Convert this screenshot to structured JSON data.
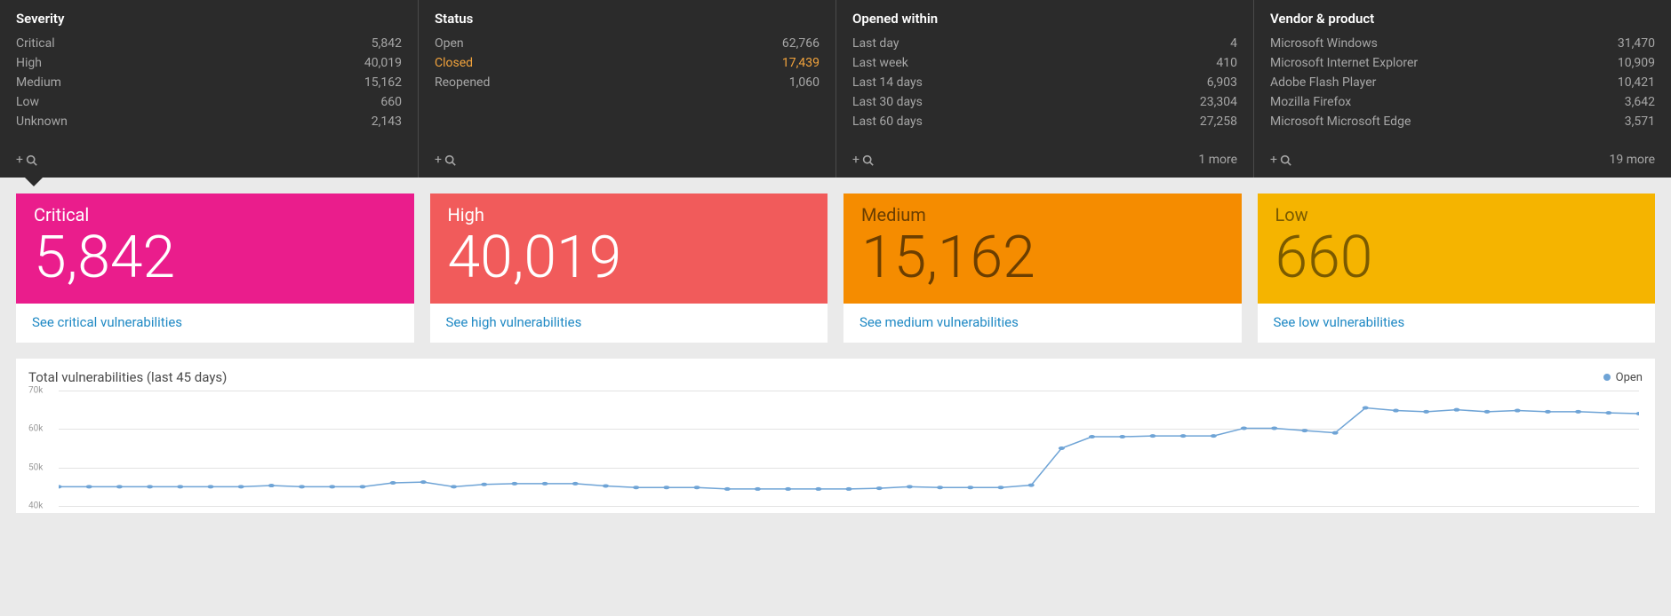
{
  "filters": {
    "severity": {
      "title": "Severity",
      "rows": [
        {
          "label": "Critical",
          "value": "5,842"
        },
        {
          "label": "High",
          "value": "40,019"
        },
        {
          "label": "Medium",
          "value": "15,162"
        },
        {
          "label": "Low",
          "value": "660"
        },
        {
          "label": "Unknown",
          "value": "2,143"
        }
      ],
      "more": ""
    },
    "status": {
      "title": "Status",
      "rows": [
        {
          "label": "Open",
          "value": "62,766"
        },
        {
          "label": "Closed",
          "value": "17,439",
          "highlight": true
        },
        {
          "label": "Reopened",
          "value": "1,060"
        }
      ],
      "more": ""
    },
    "opened": {
      "title": "Opened within",
      "rows": [
        {
          "label": "Last day",
          "value": "4"
        },
        {
          "label": "Last week",
          "value": "410"
        },
        {
          "label": "Last 14 days",
          "value": "6,903"
        },
        {
          "label": "Last 30 days",
          "value": "23,304"
        },
        {
          "label": "Last 60 days",
          "value": "27,258"
        }
      ],
      "more": "1 more"
    },
    "vendor": {
      "title": "Vendor & product",
      "rows": [
        {
          "label": "Microsoft Windows",
          "value": "31,470"
        },
        {
          "label": "Microsoft Internet Explorer",
          "value": "10,909"
        },
        {
          "label": "Adobe Flash Player",
          "value": "10,421"
        },
        {
          "label": "Mozilla Firefox",
          "value": "3,642"
        },
        {
          "label": "Microsoft Microsoft Edge",
          "value": "3,571"
        }
      ],
      "more": "19 more"
    }
  },
  "cards": {
    "critical": {
      "label": "Critical",
      "value": "5,842",
      "link": "See critical vulnerabilities"
    },
    "high": {
      "label": "High",
      "value": "40,019",
      "link": "See high vulnerabilities"
    },
    "medium": {
      "label": "Medium",
      "value": "15,162",
      "link": "See medium vulnerabilities"
    },
    "low": {
      "label": "Low",
      "value": "660",
      "link": "See low vulnerabilities"
    }
  },
  "chart": {
    "title": "Total vulnerabilities (last 45 days)",
    "legend": "Open"
  },
  "chart_data": {
    "type": "line",
    "title": "Total vulnerabilities (last 45 days)",
    "xlabel": "",
    "ylabel": "",
    "ylim": [
      40000,
      70000
    ],
    "y_ticks": [
      "40k",
      "50k",
      "60k",
      "70k"
    ],
    "series": [
      {
        "name": "Open",
        "color": "#6fa4d6",
        "x": [
          1,
          2,
          3,
          4,
          5,
          6,
          7,
          8,
          9,
          10,
          11,
          12,
          13,
          14,
          15,
          16,
          17,
          18,
          19,
          20,
          21,
          22,
          23,
          24,
          25,
          26,
          27,
          28,
          29,
          30,
          31,
          32,
          33,
          34,
          35,
          36,
          37,
          38,
          39,
          40,
          41,
          42,
          43,
          44,
          45,
          46,
          47,
          48,
          49,
          50,
          51,
          52,
          53
        ],
        "values": [
          45000,
          45000,
          45000,
          45000,
          45000,
          45000,
          45000,
          45300,
          45000,
          45000,
          45000,
          46000,
          46200,
          45000,
          45600,
          45800,
          45800,
          45800,
          45200,
          44800,
          44800,
          44800,
          44400,
          44400,
          44400,
          44400,
          44400,
          44600,
          45000,
          44800,
          44800,
          44800,
          45400,
          55000,
          58000,
          58000,
          58200,
          58200,
          58200,
          60200,
          60200,
          59600,
          59000,
          65500,
          64800,
          64500,
          65000,
          64500,
          64800,
          64500,
          64500,
          64200,
          64000
        ]
      }
    ]
  }
}
